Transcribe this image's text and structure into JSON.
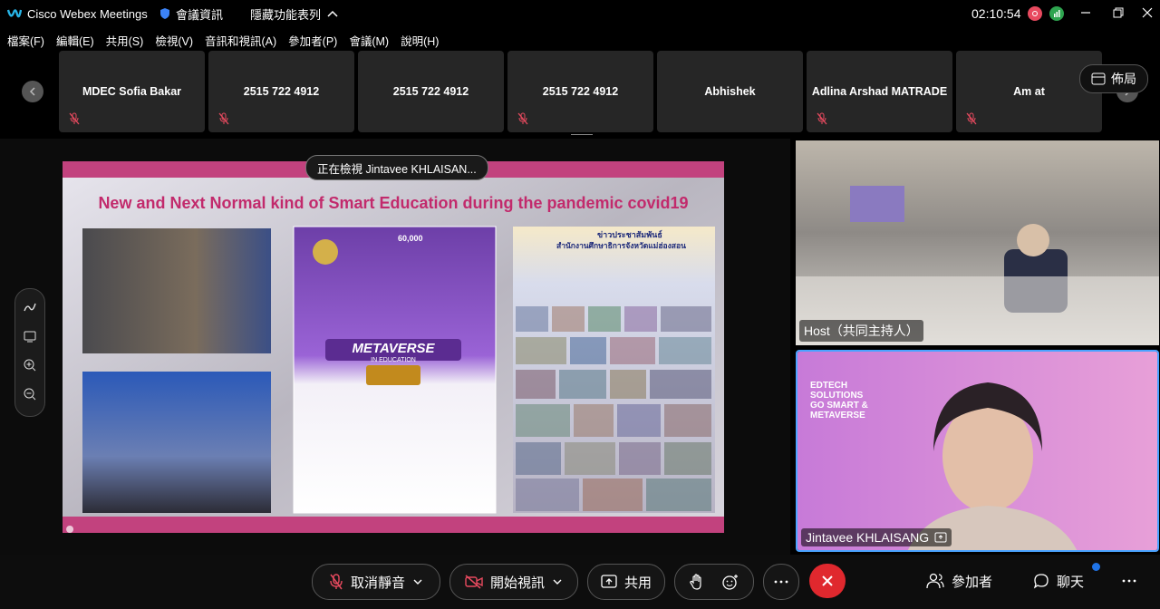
{
  "titlebar": {
    "app_name": "Cisco Webex Meetings",
    "meeting_info": "會議資訊",
    "hide_menu": "隱藏功能表列",
    "timer": "02:10:54"
  },
  "menu": {
    "items": [
      "檔案(F)",
      "編輯(E)",
      "共用(S)",
      "檢視(V)",
      "音訊和視訊(A)",
      "參加者(P)",
      "會議(M)",
      "說明(H)"
    ]
  },
  "participants": [
    {
      "name": "MDEC Sofia Bakar",
      "muted": true
    },
    {
      "name": "2515 722 4912",
      "muted": true
    },
    {
      "name": "2515 722 4912",
      "muted": false
    },
    {
      "name": "2515 722 4912",
      "muted": true
    },
    {
      "name": "Abhishek",
      "muted": false
    },
    {
      "name": "Adlina Arshad MATRADE",
      "muted": true
    },
    {
      "name": "Am at",
      "muted": true
    }
  ],
  "layout_button": "佈局",
  "share": {
    "viewing_label": "正在檢視 Jintavee KHLAISAN...",
    "slide_title": "New and Next Normal kind of Smart Education during the pandemic covid19",
    "poster_banner": "METAVERSE",
    "poster_sub": "IN EDUCATION",
    "poster_count": "60,000",
    "news_header_1": "ข่าวประชาสัมพันธ์",
    "news_header_2": "สำนักงานศึกษาธิการจังหวัดแม่ฮ่องสอน"
  },
  "videos": {
    "host_label": "Host（共同主持人）",
    "speaker_label": "Jintavee KHLAISANG",
    "speaker_bg_text": [
      "EDTECH",
      "SOLUTIONS",
      "GO SMART &",
      "METAVERSE"
    ]
  },
  "controls": {
    "unmute": "取消靜音",
    "start_video": "開始視訊",
    "share": "共用",
    "participants": "參加者",
    "chat": "聊天"
  },
  "colors": {
    "accent": "#c22a6c",
    "end_call": "#e0282e",
    "active_border": "#4aa3ff",
    "mute_red": "#e84a5f"
  }
}
